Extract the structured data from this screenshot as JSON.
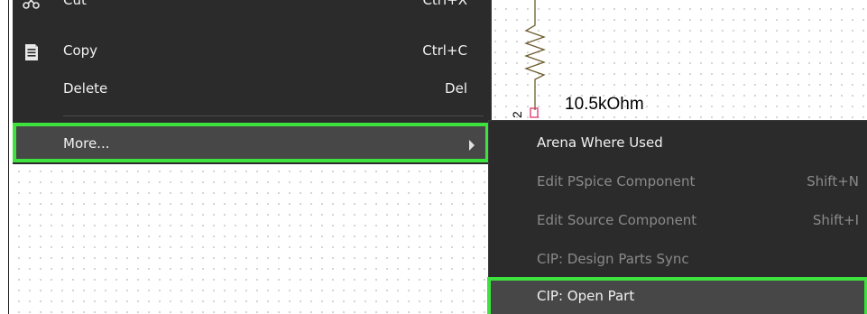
{
  "schematic": {
    "resistor_value": "10.5kOhm"
  },
  "context_menu": {
    "items": [
      {
        "label": "Cut",
        "shortcut": "Ctrl+X",
        "icon": "scissors-icon"
      },
      {
        "label": "Copy",
        "shortcut": "Ctrl+C",
        "icon": "copy-icon"
      },
      {
        "label": "Delete",
        "shortcut": "Del"
      },
      {
        "label": "More...",
        "highlighted": true,
        "has_submenu": true
      }
    ]
  },
  "submenu": {
    "items": [
      {
        "label": "Arena Where Used",
        "shortcut": "",
        "enabled": true
      },
      {
        "label": "Edit PSpice Component",
        "shortcut": "Shift+N",
        "enabled": false
      },
      {
        "label": "Edit Source Component",
        "shortcut": "Shift+I",
        "enabled": false
      },
      {
        "label": "CIP: Design Parts Sync",
        "shortcut": "",
        "enabled": false
      },
      {
        "label": "CIP: Open Part",
        "shortcut": "",
        "enabled": true,
        "highlighted": true
      }
    ]
  },
  "colors": {
    "menu_background": "#2b2b2b",
    "menu_hover": "#474747",
    "highlight_outline": "#3ee23e",
    "text_enabled": "#f2f2f2",
    "text_disabled": "#8a8a8a",
    "resistor_pin": "#e0306a"
  }
}
